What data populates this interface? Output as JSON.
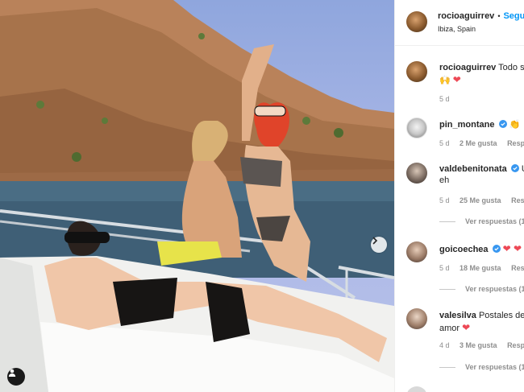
{
  "post": {
    "owner": "rocioaguirrev",
    "follow_label": "Segu",
    "dot": "•",
    "location": "Ibiza, Spain"
  },
  "comments": [
    {
      "user": "rocioaguirrev",
      "text": "Todo s",
      "text2": "🙌",
      "emoji": "❤",
      "time": "5 d"
    },
    {
      "user": "pin_montane",
      "verified": true,
      "text": "👏",
      "time": "5 d",
      "likes": "2 Me gusta",
      "reply": "Resp"
    },
    {
      "user": "valdebenitonata",
      "verified": true,
      "text": "U",
      "text2": "eh",
      "time": "5 d",
      "likes": "25 Me gusta",
      "reply": "Resp",
      "view_replies": "Ver respuestas (1)"
    },
    {
      "user": "goicoechea",
      "verified": true,
      "text": "❤ ❤",
      "time": "5 d",
      "likes": "18 Me gusta",
      "reply": "Resp",
      "view_replies": "Ver respuestas (1)"
    },
    {
      "user": "valesilva",
      "text": "Postales de",
      "text2": "amor",
      "emoji": "❤",
      "time": "4 d",
      "likes": "3 Me gusta",
      "reply": "Resp",
      "view_replies": "Ver respuestas (1)"
    }
  ],
  "icons": {
    "next": "chevron-right-icon",
    "tag": "user-tag-icon",
    "verified": "verified-badge-icon"
  },
  "colors": {
    "link": "#0095f6",
    "heart": "#ed4956",
    "verified": "#3897f0"
  }
}
